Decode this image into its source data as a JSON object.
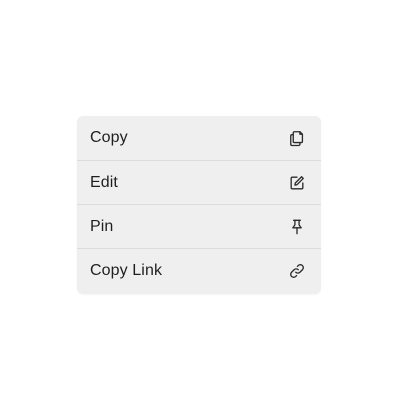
{
  "context_menu": {
    "items": [
      {
        "label": "Copy",
        "icon": "copy-icon"
      },
      {
        "label": "Edit",
        "icon": "edit-icon"
      },
      {
        "label": "Pin",
        "icon": "pin-icon"
      },
      {
        "label": "Copy Link",
        "icon": "link-icon"
      }
    ]
  },
  "colors": {
    "menu_background": "#efefef",
    "divider": "#dcdcdc",
    "text": "#1f1f1f"
  }
}
